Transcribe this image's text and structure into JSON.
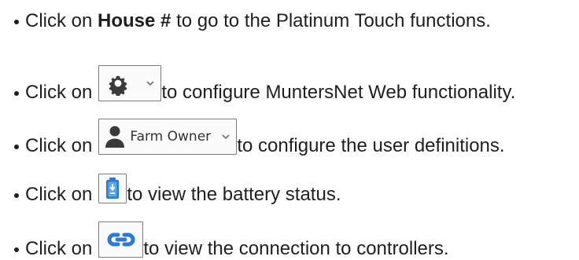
{
  "instructions": {
    "items": [
      {
        "before": "Click on",
        "bold": "House #",
        "after": "to go to the Platinum Touch functions."
      },
      {
        "before": "Click on",
        "icon": "settings-icon",
        "after": "to configure MuntersNet Web functionality."
      },
      {
        "before": "Click on",
        "icon": "user-menu-icon",
        "button_label": "Farm Owner",
        "after": "to configure the user definitions."
      },
      {
        "before": "Click on",
        "icon": "battery-icon",
        "after": "to view the battery status."
      },
      {
        "before": "Click on",
        "icon": "link-icon",
        "after": "to view the connection to controllers."
      }
    ]
  },
  "colors": {
    "text": "#1f1f1f",
    "icon_blue": "#2b7bd6",
    "icon_dark": "#3a3a3a",
    "button_border": "#7a7a7a"
  }
}
